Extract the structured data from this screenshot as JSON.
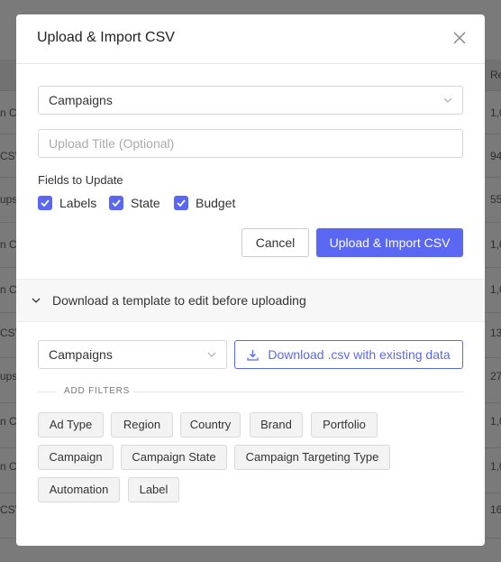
{
  "background": {
    "column_header": "Re",
    "left_fragments": [
      "n C",
      "CSV",
      "ups",
      "n C",
      "n C",
      "CSV",
      "ups",
      "n C",
      "n C",
      "CSV"
    ],
    "right_fragments": [
      "1,0",
      "94",
      "55",
      "1,0",
      "1,0",
      "13",
      "27",
      "1,0",
      "1,0",
      "16"
    ]
  },
  "modal": {
    "title": "Upload & Import CSV",
    "type_select": "Campaigns",
    "title_placeholder": "Upload Title (Optional)",
    "fields_label": "Fields to Update",
    "fields": [
      {
        "label": "Labels",
        "checked": true
      },
      {
        "label": "State",
        "checked": true
      },
      {
        "label": "Budget",
        "checked": true
      }
    ],
    "cancel_label": "Cancel",
    "submit_label": "Upload & Import CSV",
    "template_toggle": "Download a template to edit before uploading",
    "template_select": "Campaigns",
    "download_label": "Download .csv with existing data",
    "filters_label": "ADD FILTERS",
    "filters": [
      "Ad Type",
      "Region",
      "Country",
      "Brand",
      "Portfolio",
      "Campaign",
      "Campaign State",
      "Campaign Targeting Type",
      "Automation",
      "Label"
    ]
  },
  "colors": {
    "accent": "#5967f2",
    "overlay": "#7a7a7a"
  }
}
